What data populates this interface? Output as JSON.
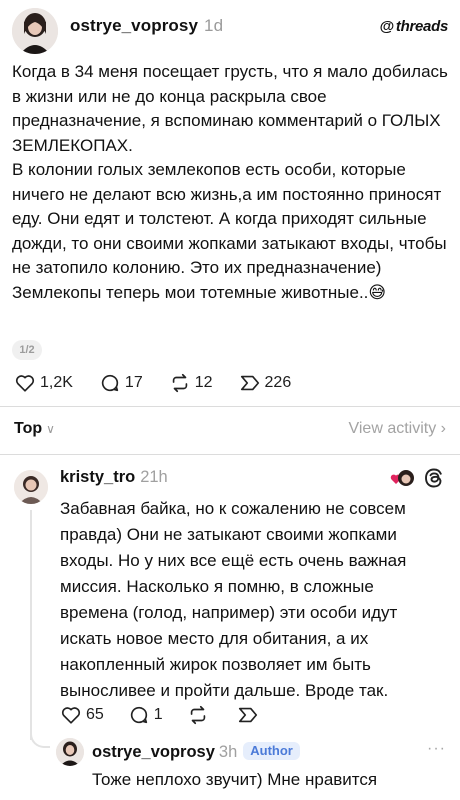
{
  "post": {
    "username": "ostrye_voprosy",
    "time": "1d",
    "brand": "threads",
    "paragraphs": [
      "Когда в 34 меня посещает грусть, что я мало добилась в жизни или не до конца раскрыла свое предназначение, я вспоминаю комментарий о ГОЛЫХ ЗЕМЛЕКОПАХ.",
      "В колонии голых землекопов есть особи, которые ничего не делают всю жизнь,а им постоянно приносят еду. Они едят и толстеют. А когда приходят сильные дожди, то они своими жопками затыкают входы, чтобы не затопило колонию. Это их предназначение)",
      "Землекопы теперь мои тотемные животные..😅"
    ],
    "page_indicator": "1/2",
    "likes": "1,2K",
    "comments": "17",
    "reposts": "12",
    "shares": "226"
  },
  "filter": {
    "sort_label": "Top",
    "view_activity": "View activity"
  },
  "comment": {
    "username": "kristy_tro",
    "time": "21h",
    "text": "Забавная байка, но к сожалению не совсем правда) Они не затыкают своими жопками входы. Но у них все ещё есть очень важная миссия. Насколько я помню, в сложные времена (голод, например) эти особи идут искать новое место для обитания, а их накопленный жирок позволяет им быть выносливее и пройти дальше. Вроде так.",
    "likes": "65",
    "comments": "1"
  },
  "reply": {
    "username": "ostrye_voprosy",
    "time": "3h",
    "badge": "Author",
    "text": "Тоже неплохо звучит) Мне нравится"
  },
  "colors": {
    "muted": "#9b9b9b",
    "author_badge_bg": "#e6eefc",
    "author_badge_text": "#4b7ad8"
  }
}
